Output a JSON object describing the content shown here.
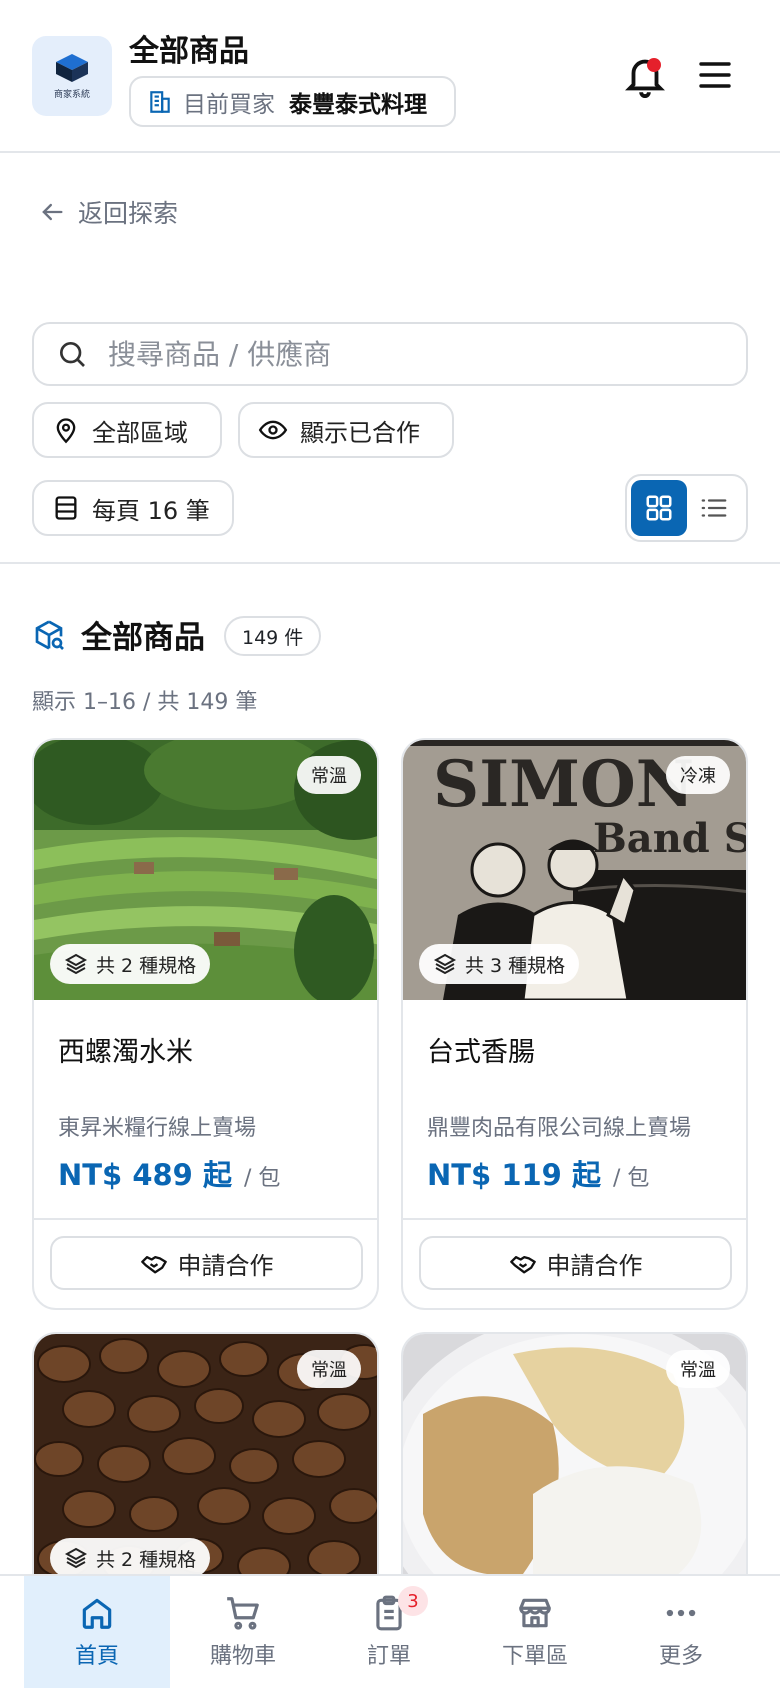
{
  "header": {
    "logo_text": "商家系統",
    "title": "全部商品",
    "buyer_label": "目前買家",
    "buyer_name": "泰豐泰式料理"
  },
  "back_link": "返回探索",
  "search": {
    "placeholder": "搜尋商品 / 供應商"
  },
  "filters": {
    "region": "全部區域",
    "show_partnered": "顯示已合作",
    "per_page": "每頁 16 筆"
  },
  "section": {
    "title": "全部商品",
    "count": "149 件",
    "range": "顯示 1–16 / 共 149 筆"
  },
  "products": [
    {
      "temp": "常溫",
      "specs": "共 2 種規格",
      "name": "西螺濁水米",
      "vendor": "東昇米糧行線上賣場",
      "price": "NT$ 489 起",
      "unit": "/ 包",
      "action": "申請合作"
    },
    {
      "temp": "冷凍",
      "specs": "共 3 種規格",
      "name": "台式香腸",
      "vendor": "鼎豐肉品有限公司線上賣場",
      "price": "NT$ 119 起",
      "unit": "/ 包",
      "action": "申請合作"
    },
    {
      "temp": "常溫",
      "specs": "共 2 種規格"
    },
    {
      "temp": "常溫"
    }
  ],
  "image_text": {
    "sign_line1": "SIMON",
    "sign_line2": "Band S"
  },
  "bottom_nav": [
    {
      "label": "首頁",
      "icon": "home-icon"
    },
    {
      "label": "購物車",
      "icon": "cart-icon"
    },
    {
      "label": "訂單",
      "icon": "clipboard-icon",
      "badge": "3"
    },
    {
      "label": "下單區",
      "icon": "store-icon"
    },
    {
      "label": "更多",
      "icon": "more-icon"
    }
  ],
  "colors": {
    "accent": "#0a66b3",
    "notification": "#e5202b",
    "active_nav_bg": "#e1effc"
  }
}
